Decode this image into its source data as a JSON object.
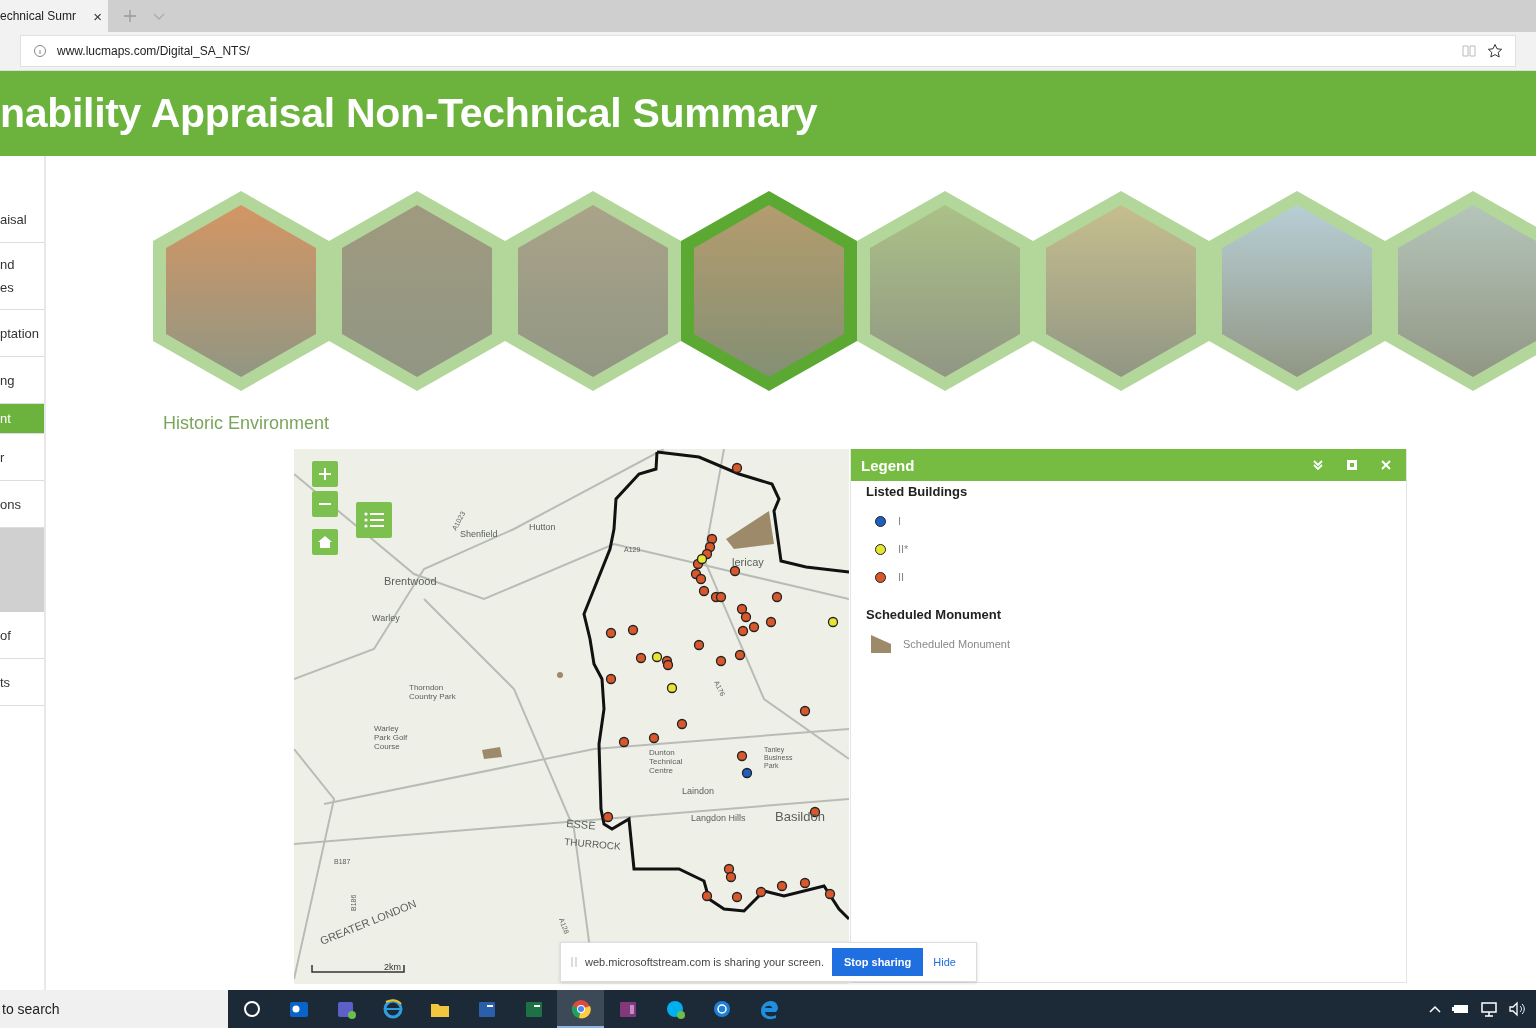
{
  "browser": {
    "tab": {
      "title": "echnical Sumr",
      "close": "×"
    },
    "url": "www.lucmaps.com/Digital_SA_NTS/"
  },
  "header": {
    "title": "nability Appraisal Non-Technical Summary"
  },
  "sidebar": {
    "items": [
      {
        "kind": "link",
        "label": "aisal",
        "selected": false
      },
      {
        "kind": "link",
        "label": "nd\nes",
        "selected": false
      },
      {
        "kind": "link",
        "label": "ptation",
        "selected": false
      },
      {
        "kind": "link",
        "label": "ng",
        "selected": false
      },
      {
        "kind": "link",
        "label": "nt",
        "selected": true
      },
      {
        "kind": "link",
        "label": "r",
        "selected": false
      },
      {
        "kind": "link",
        "label": "ons",
        "selected": false
      },
      {
        "kind": "blank",
        "selected": false
      },
      {
        "kind": "link",
        "label": "of",
        "selected": false
      },
      {
        "kind": "link",
        "label": "ts",
        "selected": false
      }
    ]
  },
  "topics": [
    {
      "selected": false
    },
    {
      "selected": false
    },
    {
      "selected": false
    },
    {
      "selected": true
    },
    {
      "selected": false
    },
    {
      "selected": false
    },
    {
      "selected": false
    },
    {
      "selected": false
    }
  ],
  "section": {
    "title": "Historic Environment"
  },
  "map": {
    "labels": [
      "Shenfield",
      "Hutton",
      "Brentwood",
      "Warley",
      "Thorndon\nCountry Park",
      "Warley\nPark Golf\nCourse",
      "lericay",
      "Dunton\nTechnical\nCentre",
      "Laindon",
      "Langdon Hills",
      "Basildon",
      "ESSE",
      "THURROCK",
      "GREATER LONDON",
      "A1023",
      "A129",
      "A176",
      "B187",
      "B186",
      "A128",
      "Tanley\nBusiness\nPark"
    ],
    "scale": "2km"
  },
  "legend": {
    "title": "Legend",
    "groups": [
      {
        "title": "Listed Buildings",
        "items": [
          {
            "kind": "dot",
            "label": "I",
            "color": "#1f5fbf"
          },
          {
            "kind": "dot",
            "label": "II*",
            "color": "#e6e632"
          },
          {
            "kind": "dot",
            "label": "II",
            "color": "#d9582b"
          }
        ]
      },
      {
        "title": "Scheduled Monument",
        "items": [
          {
            "kind": "area",
            "label": "Scheduled Monument",
            "color": "#9c8a6a"
          }
        ]
      }
    ]
  },
  "share_bar": {
    "message": "web.microsoftstream.com is sharing your screen.",
    "stop": "Stop sharing",
    "hide": "Hide"
  },
  "taskbar": {
    "search": "to search",
    "apps": [
      {
        "kind": "cortana",
        "selected": false
      },
      {
        "kind": "outlook",
        "selected": false
      },
      {
        "kind": "teams",
        "selected": false
      },
      {
        "kind": "ie",
        "selected": false
      },
      {
        "kind": "explorer",
        "selected": false
      },
      {
        "kind": "word",
        "selected": false
      },
      {
        "kind": "excel",
        "selected": false
      },
      {
        "kind": "chrome",
        "selected": true
      },
      {
        "kind": "onenote",
        "selected": false
      },
      {
        "kind": "skype",
        "selected": false
      },
      {
        "kind": "app",
        "selected": false
      },
      {
        "kind": "edge",
        "selected": false
      }
    ]
  }
}
